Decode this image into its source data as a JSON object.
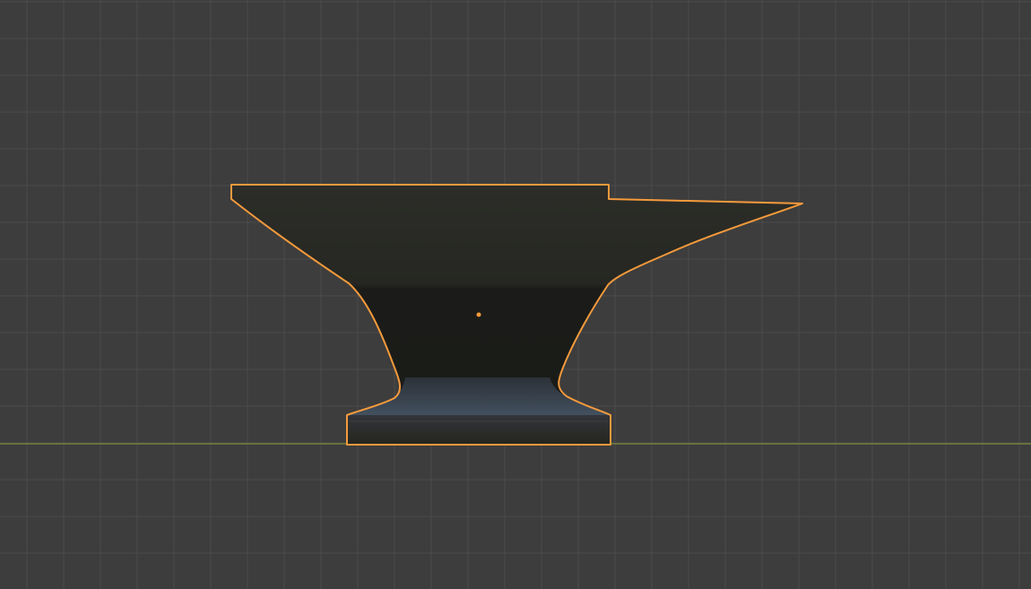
{
  "viewport": {
    "view": "orthographic-side",
    "background_color": "#3d3d3d",
    "grid_color": "#4a4a4a",
    "grid_visible": true,
    "ground_axis_color": "#7e8c3a",
    "ground_axis": "x"
  },
  "object": {
    "name": "anvil",
    "selected": true,
    "selection_outline_color": "#f59a3c",
    "origin_color": "#f59a3c",
    "body_color": "#1e1f1b",
    "upper_body_color": "#2a2b26",
    "step_color": "#3a4552",
    "base_color": "#2b2c27"
  }
}
